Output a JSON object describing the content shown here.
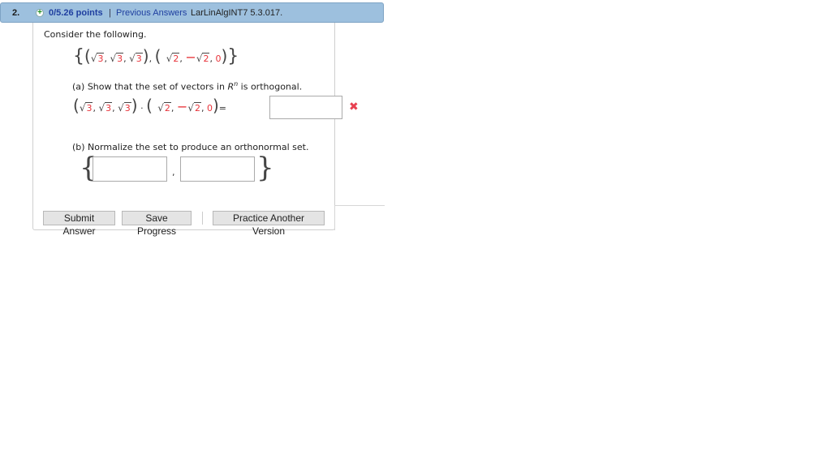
{
  "header": {
    "question_number": "2.",
    "points": "0/5.26 points",
    "separator": "|",
    "previous_answers": "Previous Answers",
    "problem_code": "LarLinAlgINT7 5.3.017."
  },
  "question": {
    "intro": "Consider the following.",
    "set": {
      "v1": [
        "3",
        "3",
        "3"
      ],
      "v2": [
        "2",
        "2",
        "0"
      ],
      "v2_signs": [
        "",
        "−",
        ""
      ]
    },
    "part_a": {
      "label": "(a) Show that the set of vectors in ",
      "space": "R",
      "exponent": "n",
      "label_end": " is orthogonal.",
      "equals": "=",
      "answer_value": "",
      "status": "incorrect"
    },
    "part_b": {
      "label": "(b) Normalize the set to produce an orthonormal set.",
      "answer_1": "",
      "answer_2": "",
      "comma": ","
    }
  },
  "buttons": {
    "submit": "Submit Answer",
    "save": "Save Progress",
    "practice": "Practice Another Version"
  },
  "colors": {
    "header_bg": "#9dc0de",
    "link": "#1f3fa0",
    "red_value": "#e8333a",
    "incorrect_mark": "#e84050"
  }
}
